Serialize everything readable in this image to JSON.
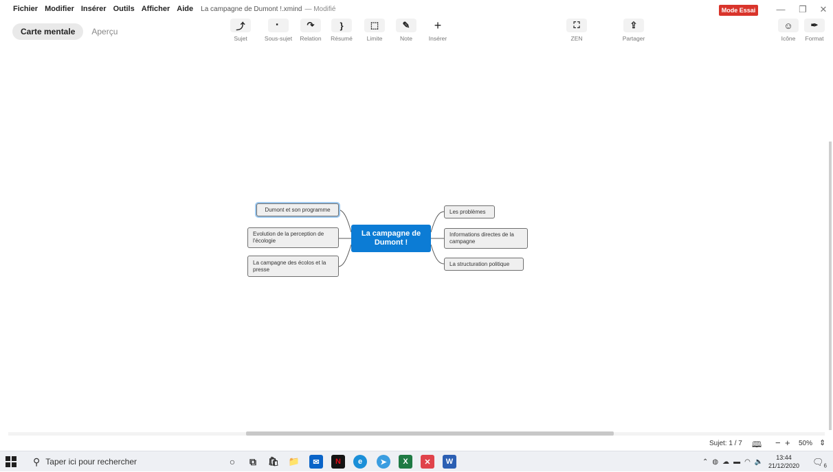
{
  "menubar": {
    "items": [
      "Fichier",
      "Modifier",
      "Insérer",
      "Outils",
      "Afficher",
      "Aide"
    ],
    "doc_title": "La campagne de Dumont !.xmind",
    "doc_status": "— Modifié",
    "trial_badge": "Mode Essai",
    "window_controls": {
      "minimize": "—",
      "restore": "❐",
      "close": "✕"
    }
  },
  "toolbar": {
    "view_mindmap": "Carte mentale",
    "view_preview": "Aperçu",
    "tools": [
      {
        "label": "Sujet",
        "icon": "topic-icon",
        "glyph": "⤴"
      },
      {
        "label": "Sous-sujet",
        "icon": "subtopic-icon",
        "glyph": "⠂"
      },
      {
        "label": "Relation",
        "icon": "relation-icon",
        "glyph": "↷"
      },
      {
        "label": "Résumé",
        "icon": "summary-icon",
        "glyph": "}"
      },
      {
        "label": "Limite",
        "icon": "boundary-icon",
        "glyph": "⬚"
      },
      {
        "label": "Note",
        "icon": "note-icon",
        "glyph": "✎"
      },
      {
        "label": "Insérer",
        "icon": "insert-icon",
        "glyph": "+"
      }
    ],
    "zen": {
      "label": "ZEN",
      "icon": "zen-icon",
      "glyph": "⛶"
    },
    "share": {
      "label": "Partager",
      "icon": "share-icon",
      "glyph": "⇪"
    },
    "icon_panel": {
      "label": "Icône",
      "icon": "emoji-icon",
      "glyph": "☺"
    },
    "format_panel": {
      "label": "Format",
      "icon": "format-icon",
      "glyph": "✒"
    }
  },
  "mindmap": {
    "central": "La campagne de Dumont !",
    "left_topics": [
      "Dumont et son programme",
      "Evolution de la perception de l'écologie",
      "La campagne des écolos et la presse"
    ],
    "right_topics": [
      "Les problèmes",
      "Informations directes de la campagne",
      "La structuration politique"
    ],
    "selected_topic": "Dumont et son programme"
  },
  "statusbar": {
    "topic_count": "Sujet: 1 / 7",
    "map_icon": "map-icon",
    "zoom_minus": "−",
    "zoom_plus": "+",
    "zoom": "50%",
    "zoom_arrow": "⇕"
  },
  "taskbar": {
    "search_placeholder": "Taper ici pour rechercher",
    "apps": [
      {
        "name": "cortana",
        "glyph": "○",
        "color": "#333333"
      },
      {
        "name": "task-view",
        "glyph": "⧉",
        "color": "#333333"
      },
      {
        "name": "store",
        "glyph": "🛍",
        "color": "#333333"
      },
      {
        "name": "file-explorer",
        "glyph": "📁",
        "color": "#f2b01e"
      },
      {
        "name": "mail",
        "glyph": "✉",
        "color": "#0a64c8"
      },
      {
        "name": "netflix",
        "glyph": "N",
        "color": "#141414"
      },
      {
        "name": "edge",
        "glyph": "e",
        "color": "#1b8fd8"
      },
      {
        "name": "telegram",
        "glyph": "➤",
        "color": "#3a9de0"
      },
      {
        "name": "excel",
        "glyph": "X",
        "color": "#1f7a44"
      },
      {
        "name": "xmind",
        "glyph": "✕",
        "color": "#e0434b"
      },
      {
        "name": "word",
        "glyph": "W",
        "color": "#2b5fb3"
      }
    ],
    "time": "13:44",
    "date": "21/12/2020",
    "notifications": "6"
  }
}
